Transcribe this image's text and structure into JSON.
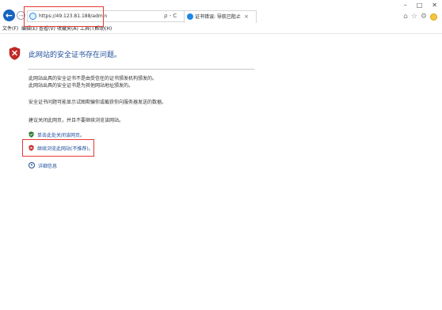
{
  "browser": {
    "address": {
      "url": "https://49.123.81.188/admin",
      "tools": "ρ - C"
    },
    "tab": {
      "title": "证书错误: 导航已阻止",
      "close": "×"
    },
    "window_controls": {
      "minimize": "–",
      "maximize": "□",
      "close": "✕"
    },
    "favorites_icons": [
      "⌂",
      "☆",
      "⚙"
    ],
    "menu": [
      {
        "label": "文件(F)"
      },
      {
        "label": "编辑(E)"
      },
      {
        "label": "查看(V)"
      },
      {
        "label": "收藏夹(A)"
      },
      {
        "label": "工具(T)"
      },
      {
        "label": "帮助(H)"
      }
    ]
  },
  "page": {
    "headline": "此网站的安全证书存在问题。",
    "paragraphs": {
      "p1": "此网站出具的安全证书不是由受信任的证书颁发机构颁发的。",
      "p2": "此网站出具的安全证书是为其他网站地址颁发的。",
      "p3": "安全证书问题可能显示试图欺骗你或截获你向服务器发送的数据。",
      "p4": "建议关闭此网页，并且不要继续浏览该网站。"
    },
    "actions": {
      "close_label": "单击此处关闭该网页。",
      "continue_label": "继续浏览此网站(不推荐)。",
      "details_label": "详细信息"
    }
  },
  "colors": {
    "accent": "#1f4e9a",
    "annotation": "#e53935",
    "warning_red": "#c62828",
    "safe_green": "#2e7d32"
  }
}
